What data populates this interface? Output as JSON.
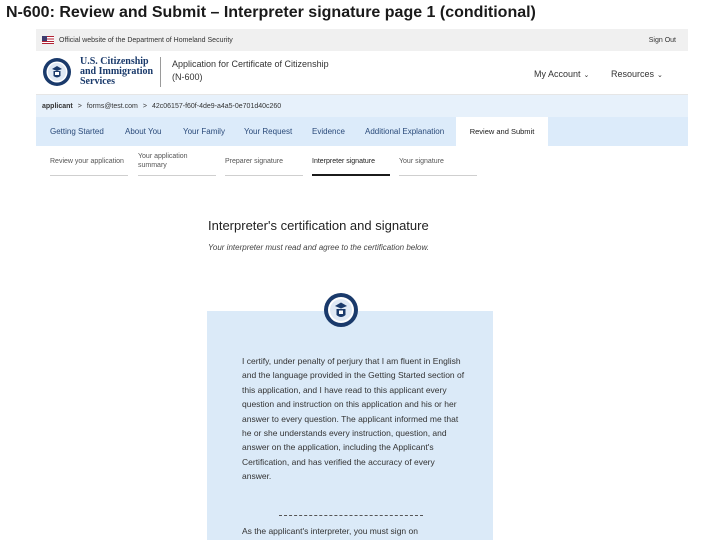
{
  "slide": {
    "title": "N-600: Review and Submit – Interpreter signature page 1 (conditional)"
  },
  "gov_banner": {
    "text": "Official website of the Department of Homeland Security",
    "sign_out": "Sign Out"
  },
  "header": {
    "agency_lines": [
      "U.S. Citizenship",
      "and Immigration",
      "Services"
    ],
    "app_title": "Application for Certificate of Citizenship",
    "app_form": "(N-600)",
    "nav": {
      "my_account": "My Account",
      "resources": "Resources"
    }
  },
  "breadcrumb": {
    "items": [
      "applicant",
      "forms@test.com",
      "42c06157-f60f-4de9-a4a5-0e701d40c260"
    ]
  },
  "tabs": {
    "items": [
      "Getting Started",
      "About You",
      "Your Family",
      "Your Request",
      "Evidence",
      "Additional Explanation"
    ],
    "active": "Review and Submit"
  },
  "subtabs": {
    "items": [
      "Review your application",
      "Your application summary",
      "Preparer signature",
      "Interpreter signature",
      "Your signature"
    ],
    "active_index": 3
  },
  "main": {
    "heading": "Interpreter's certification and signature",
    "subheading": "Your interpreter must read and agree to the certification below.",
    "certification": "I certify, under penalty of perjury that I am fluent in English and the language provided in the Getting Started section of this application, and I have read to this applicant every question and instruction on this application and his or her answer to every question. The applicant informed me that he or she understands every instruction, question, and answer on the application, including the Applicant's Certification, and has verified the accuracy of every answer.",
    "note": "As the applicant's interpreter, you must sign on"
  },
  "colors": {
    "tab_bar": "#dcebfa",
    "breadcrumb_bar": "#e7f1fb",
    "cert_box": "#dbeaf8",
    "agency_blue": "#1a3a6b"
  },
  "icons": [
    "us-flag-icon",
    "dhs-seal-icon",
    "chevron-down-icon"
  ]
}
